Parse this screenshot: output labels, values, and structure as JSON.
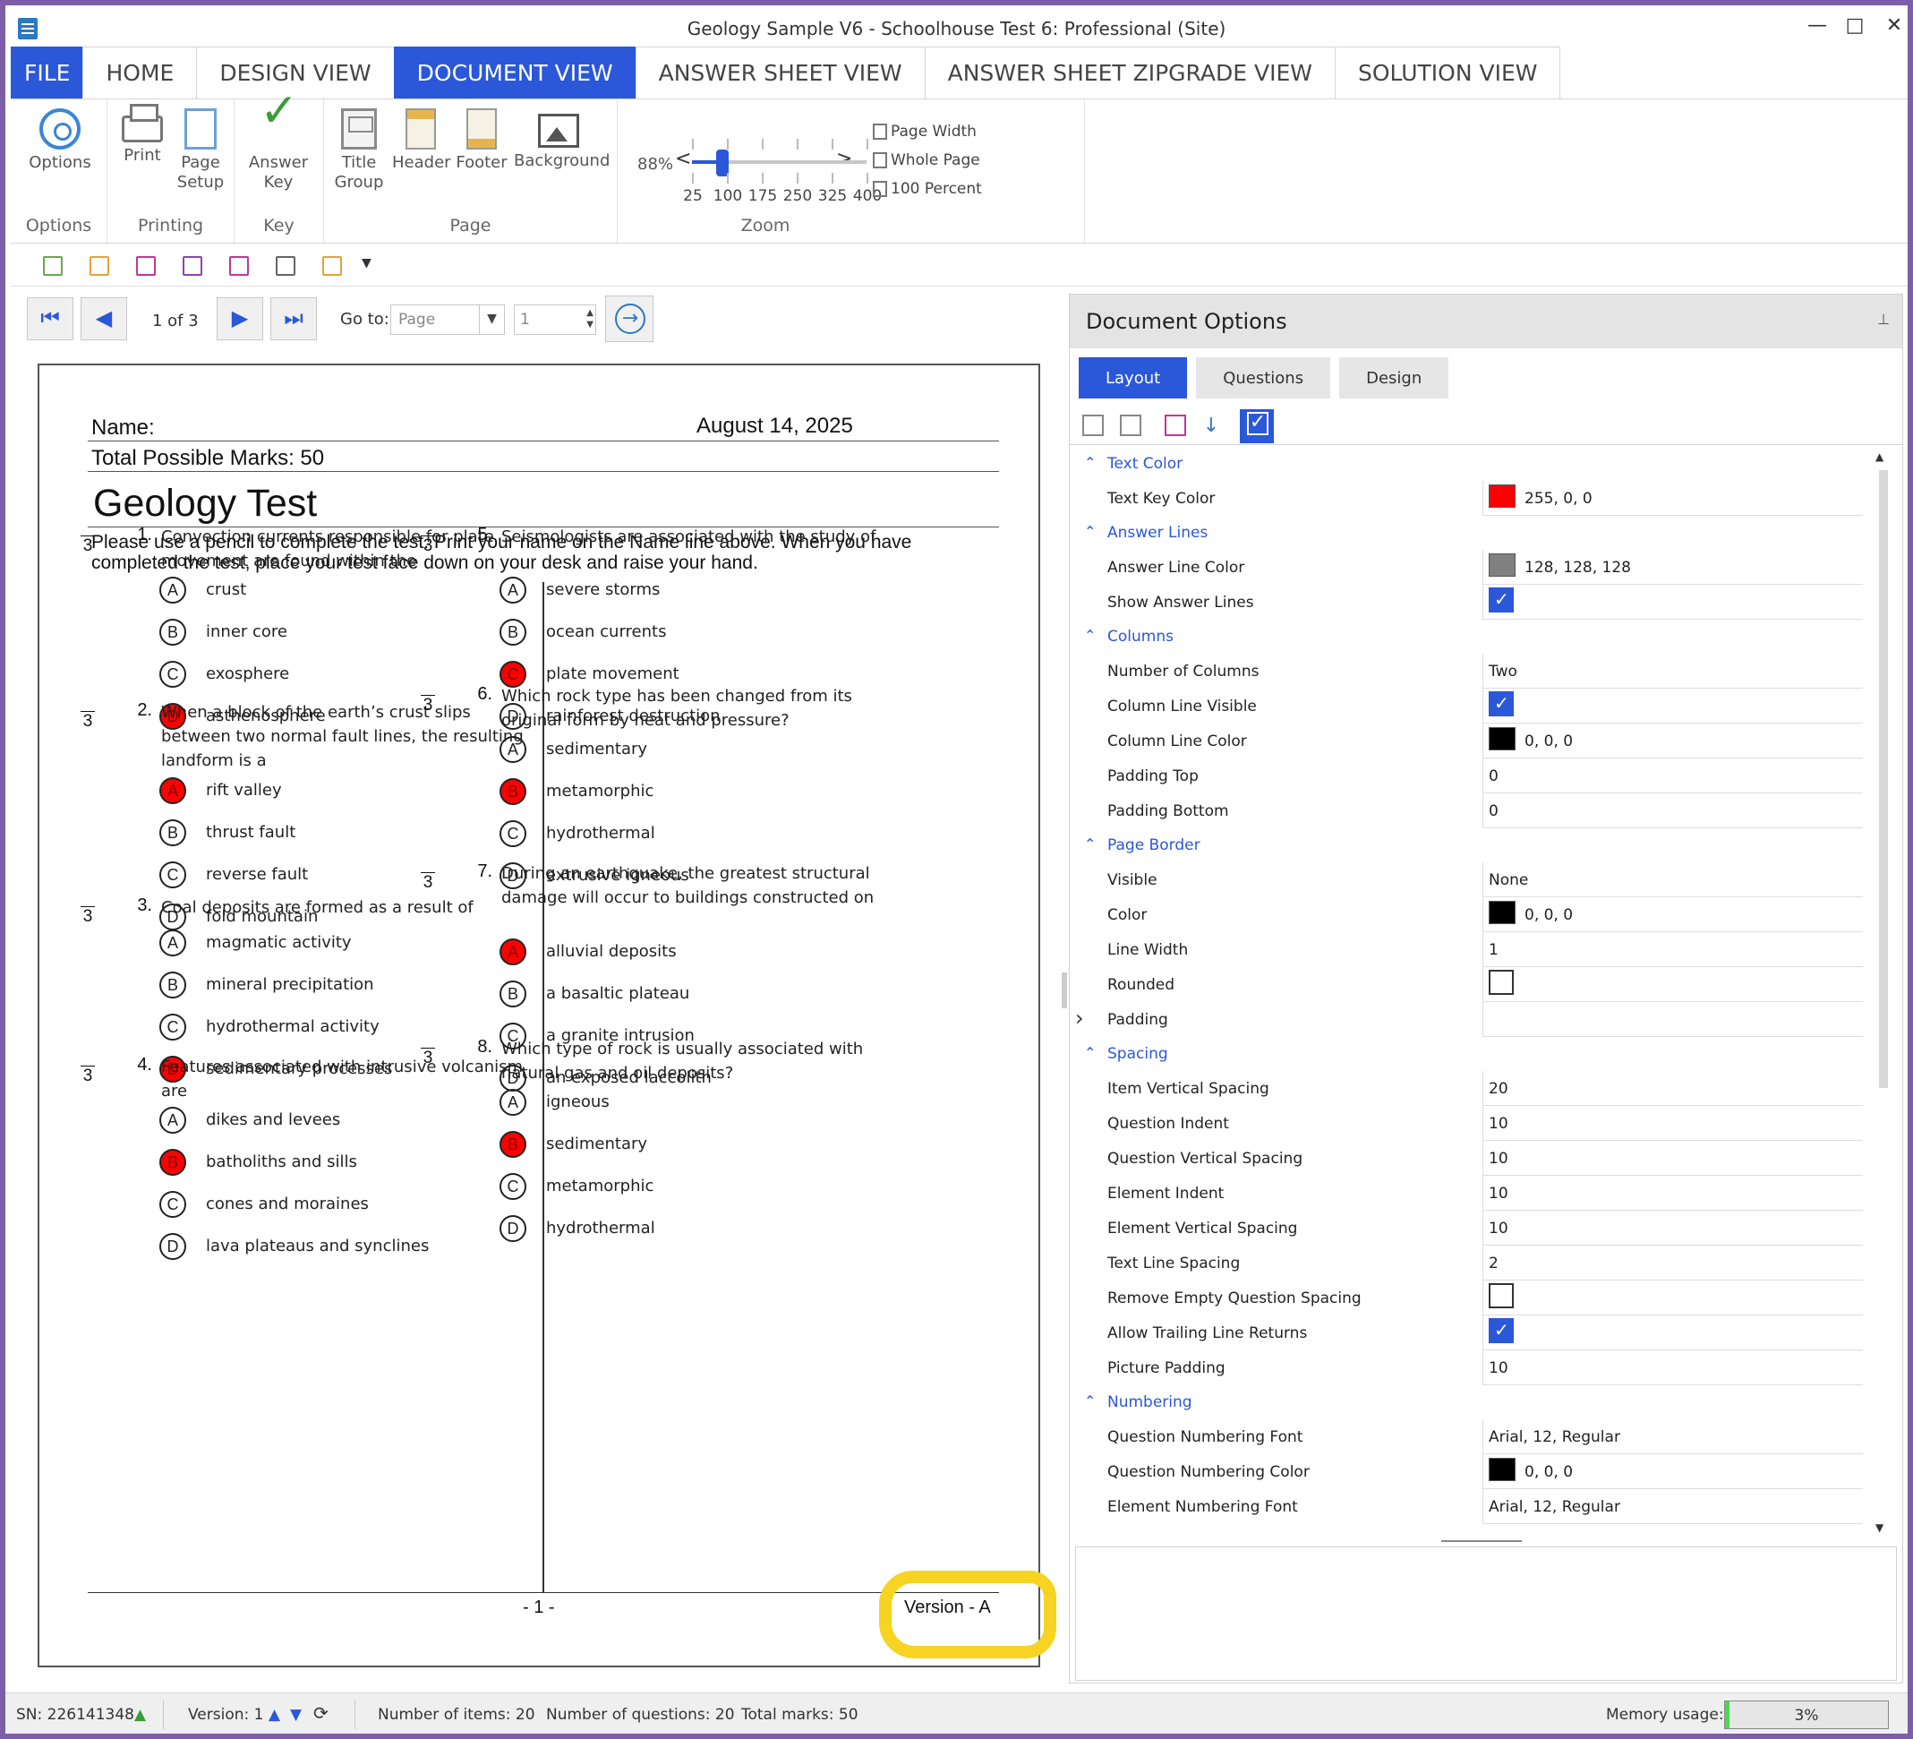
{
  "window": {
    "title": "Geology Sample V6 - Schoolhouse Test 6: Professional (Site)",
    "minimize": "—",
    "maximize": "□",
    "close": "✕"
  },
  "tabs": [
    "FILE",
    "HOME",
    "DESIGN VIEW",
    "DOCUMENT VIEW",
    "ANSWER SHEET VIEW",
    "ANSWER SHEET ZIPGRADE VIEW",
    "SOLUTION VIEW"
  ],
  "active_tab": "DOCUMENT VIEW",
  "ribbon": {
    "groups": {
      "options": "Options",
      "printing": "Printing",
      "key": "Key",
      "page": "Page",
      "zoom": "Zoom"
    },
    "buttons": {
      "options": "Options",
      "print": "Print",
      "page_setup_1": "Page",
      "page_setup_2": "Setup",
      "answer_key_1": "Answer",
      "answer_key_2": "Key",
      "title_group_1": "Title",
      "title_group_2": "Group",
      "header": "Header",
      "footer": "Footer",
      "background": "Background"
    },
    "zoom": {
      "percent": "88%",
      "value": 88,
      "ticks": [
        "25",
        "100",
        "175",
        "250",
        "325",
        "400"
      ],
      "prev": "<",
      "next": ">",
      "page_width": "Page Width",
      "whole_page": "Whole Page",
      "hundred_percent": "100 Percent"
    }
  },
  "quick_access": {
    "overflow": "▼"
  },
  "nav": {
    "first": "⏮",
    "prev": "◀",
    "page_of": "1 of 3",
    "next": "▶",
    "last": "⏭",
    "goto_label": "Go to:",
    "goto_placeholder": "Page",
    "goto_number": "1",
    "go": "→"
  },
  "document": {
    "name_label": "Name:",
    "date": "August 14, 2025",
    "total_marks": "Total Possible Marks: 50",
    "title": "Geology Test",
    "instructions": "Please use a pencil to complete the test. Print your name on the Name line above. When you have completed the test, place your test face down on your desk and raise your hand.",
    "page_number": "- 1 -",
    "version": "Version - A",
    "questions": [
      {
        "num": "1.",
        "marks": "3",
        "text": "Convection currents responsible for plate movement are found within the",
        "options": [
          {
            "letter": "A",
            "text": "crust",
            "key": false
          },
          {
            "letter": "B",
            "text": "inner core",
            "key": false
          },
          {
            "letter": "C",
            "text": "exosphere",
            "key": false
          },
          {
            "letter": "D",
            "text": "asthenosphere",
            "key": true
          }
        ]
      },
      {
        "num": "2.",
        "marks": "3",
        "text": "When a block of the earth’s crust slips between two normal fault lines, the resulting landform is a",
        "options": [
          {
            "letter": "A",
            "text": "rift valley",
            "key": true
          },
          {
            "letter": "B",
            "text": "thrust fault",
            "key": false
          },
          {
            "letter": "C",
            "text": "reverse fault",
            "key": false
          },
          {
            "letter": "D",
            "text": "fold mountain",
            "key": false
          }
        ]
      },
      {
        "num": "3.",
        "marks": "3",
        "text": "Coal deposits are formed as a result of",
        "options": [
          {
            "letter": "A",
            "text": "magmatic activity",
            "key": false
          },
          {
            "letter": "B",
            "text": "mineral precipitation",
            "key": false
          },
          {
            "letter": "C",
            "text": "hydrothermal activity",
            "key": false
          },
          {
            "letter": "D",
            "text": "sedimentary processes",
            "key": true
          }
        ]
      },
      {
        "num": "4.",
        "marks": "3",
        "text": "Features associated with intrusive volcanism are",
        "options": [
          {
            "letter": "A",
            "text": "dikes and levees",
            "key": false
          },
          {
            "letter": "B",
            "text": "batholiths and sills",
            "key": true
          },
          {
            "letter": "C",
            "text": "cones and moraines",
            "key": false
          },
          {
            "letter": "D",
            "text": "lava plateaus and synclines",
            "key": false
          }
        ]
      },
      {
        "num": "5.",
        "marks": "3",
        "text": "Seismologists are associated with the study of",
        "options": [
          {
            "letter": "A",
            "text": "severe storms",
            "key": false
          },
          {
            "letter": "B",
            "text": "ocean currents",
            "key": false
          },
          {
            "letter": "C",
            "text": "plate movement",
            "key": true
          },
          {
            "letter": "D",
            "text": "rainforest destruction",
            "key": false
          }
        ]
      },
      {
        "num": "6.",
        "marks": "3",
        "text": "Which rock type has been changed from its original form by heat and pressure?",
        "options": [
          {
            "letter": "A",
            "text": "sedimentary",
            "key": false
          },
          {
            "letter": "B",
            "text": "metamorphic",
            "key": true
          },
          {
            "letter": "C",
            "text": "hydrothermal",
            "key": false
          },
          {
            "letter": "D",
            "text": "extrusive igneous",
            "key": false
          }
        ]
      },
      {
        "num": "7.",
        "marks": "3",
        "text": "During an earthquake, the greatest structural damage will occur to buildings constructed on",
        "options": [
          {
            "letter": "A",
            "text": "alluvial deposits",
            "key": true
          },
          {
            "letter": "B",
            "text": "a basaltic plateau",
            "key": false
          },
          {
            "letter": "C",
            "text": "a granite intrusion",
            "key": false
          },
          {
            "letter": "D",
            "text": "an exposed laccolith",
            "key": false
          }
        ]
      },
      {
        "num": "8.",
        "marks": "3",
        "text": "Which type of rock is usually associated with natural gas and oil deposits?",
        "options": [
          {
            "letter": "A",
            "text": "igneous",
            "key": false
          },
          {
            "letter": "B",
            "text": "sedimentary",
            "key": true
          },
          {
            "letter": "C",
            "text": "metamorphic",
            "key": false
          },
          {
            "letter": "D",
            "text": "hydrothermal",
            "key": false
          }
        ]
      }
    ]
  },
  "panel": {
    "title": "Document Options",
    "pin": "📌",
    "tabs": [
      "Layout",
      "Questions",
      "Design"
    ],
    "active_tab": "Layout",
    "categories": [
      {
        "label": "Text Color",
        "expanded": true,
        "rows": [
          {
            "name": "Text Key Color",
            "value": "255, 0, 0",
            "swatch": "#ff0000"
          }
        ]
      },
      {
        "label": "Answer Lines",
        "expanded": true,
        "rows": [
          {
            "name": "Answer Line Color",
            "value": "128, 128, 128",
            "swatch": "#808080"
          },
          {
            "name": "Show Answer Lines",
            "checkbox": true
          }
        ]
      },
      {
        "label": "Columns",
        "expanded": true,
        "rows": [
          {
            "name": "Number of Columns",
            "value": "Two"
          },
          {
            "name": "Column Line Visible",
            "checkbox": true
          },
          {
            "name": "Column Line Color",
            "value": "0, 0, 0",
            "swatch": "#000000"
          },
          {
            "name": "Padding Top",
            "value": "0"
          },
          {
            "name": "Padding Bottom",
            "value": "0"
          }
        ]
      },
      {
        "label": "Page Border",
        "expanded": true,
        "rows": [
          {
            "name": "Visible",
            "value": "None"
          },
          {
            "name": "Color",
            "value": "0, 0, 0",
            "swatch": "#000000"
          },
          {
            "name": "Line Width",
            "value": "1"
          },
          {
            "name": "Rounded",
            "checkbox": false
          },
          {
            "name": "Padding",
            "value": "",
            "expander": true
          }
        ]
      },
      {
        "label": "Spacing",
        "expanded": true,
        "rows": [
          {
            "name": "Item Vertical Spacing",
            "value": "20"
          },
          {
            "name": "Question Indent",
            "value": "10"
          },
          {
            "name": "Question Vertical Spacing",
            "value": "10"
          },
          {
            "name": "Element Indent",
            "value": "10"
          },
          {
            "name": "Element Vertical Spacing",
            "value": "10"
          },
          {
            "name": "Text Line Spacing",
            "value": "2"
          },
          {
            "name": "Remove Empty Question Spacing",
            "checkbox": false
          },
          {
            "name": "Allow Trailing Line Returns",
            "checkbox": true
          },
          {
            "name": "Picture Padding",
            "value": "10"
          }
        ]
      },
      {
        "label": "Numbering",
        "expanded": true,
        "rows": [
          {
            "name": "Question Numbering Font",
            "value": "Arial, 12, Regular"
          },
          {
            "name": "Question Numbering Color",
            "value": "0, 0, 0",
            "swatch": "#000000"
          },
          {
            "name": "Element Numbering Font",
            "value": "Arial, 12, Regular"
          }
        ]
      }
    ]
  },
  "status": {
    "sn": "SN:  226141348",
    "version": "Version: 1",
    "items": "Number of items: 20",
    "questions": "Number of questions: 20",
    "total_marks": "Total marks: 50",
    "memory_label": "Memory usage:",
    "memory_value": "3%",
    "memory_fraction": 0.03
  },
  "colors": {
    "accent": "#2b57d9",
    "key_bubble": "#ff0000",
    "highlight": "#f7d322",
    "window_border": "#7b5ea7"
  }
}
